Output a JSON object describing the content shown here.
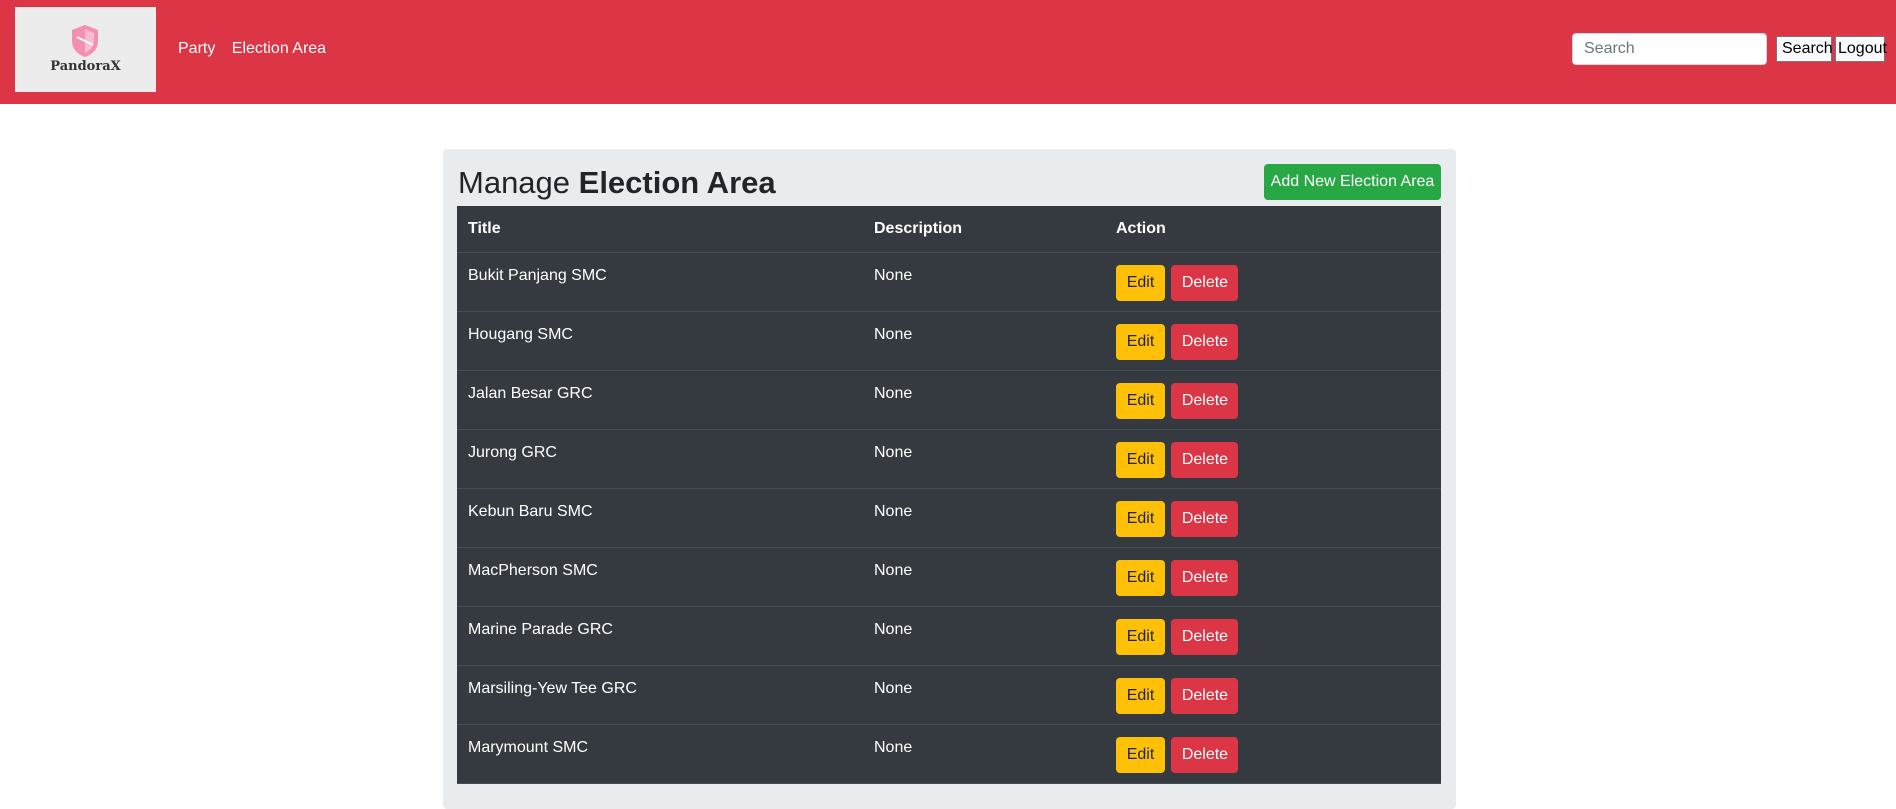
{
  "brand": {
    "logo_text": "PandoraX"
  },
  "nav": {
    "links": [
      "Party",
      "Election Area"
    ]
  },
  "search": {
    "placeholder": "Search",
    "button_label": "Search"
  },
  "logout_label": "Logout",
  "page": {
    "title_prefix": "Manage ",
    "title_bold": "Election Area",
    "add_button": "Add New Election Area"
  },
  "table": {
    "headers": [
      "Title",
      "Description",
      "Action"
    ],
    "rows": [
      {
        "title": "Bukit Panjang SMC",
        "description": "None"
      },
      {
        "title": "Hougang SMC",
        "description": "None"
      },
      {
        "title": "Jalan Besar GRC",
        "description": "None"
      },
      {
        "title": "Jurong GRC",
        "description": "None"
      },
      {
        "title": "Kebun Baru SMC",
        "description": "None"
      },
      {
        "title": "MacPherson SMC",
        "description": "None"
      },
      {
        "title": "Marine Parade GRC",
        "description": "None"
      },
      {
        "title": "Marsiling-Yew Tee GRC",
        "description": "None"
      },
      {
        "title": "Marymount SMC",
        "description": "None"
      }
    ],
    "edit_label": "Edit",
    "delete_label": "Delete"
  },
  "colors": {
    "navbar": "#dc3545",
    "add_button": "#28a745",
    "edit_button": "#ffc107",
    "delete_button": "#dc3545",
    "table_bg": "#343a40"
  }
}
